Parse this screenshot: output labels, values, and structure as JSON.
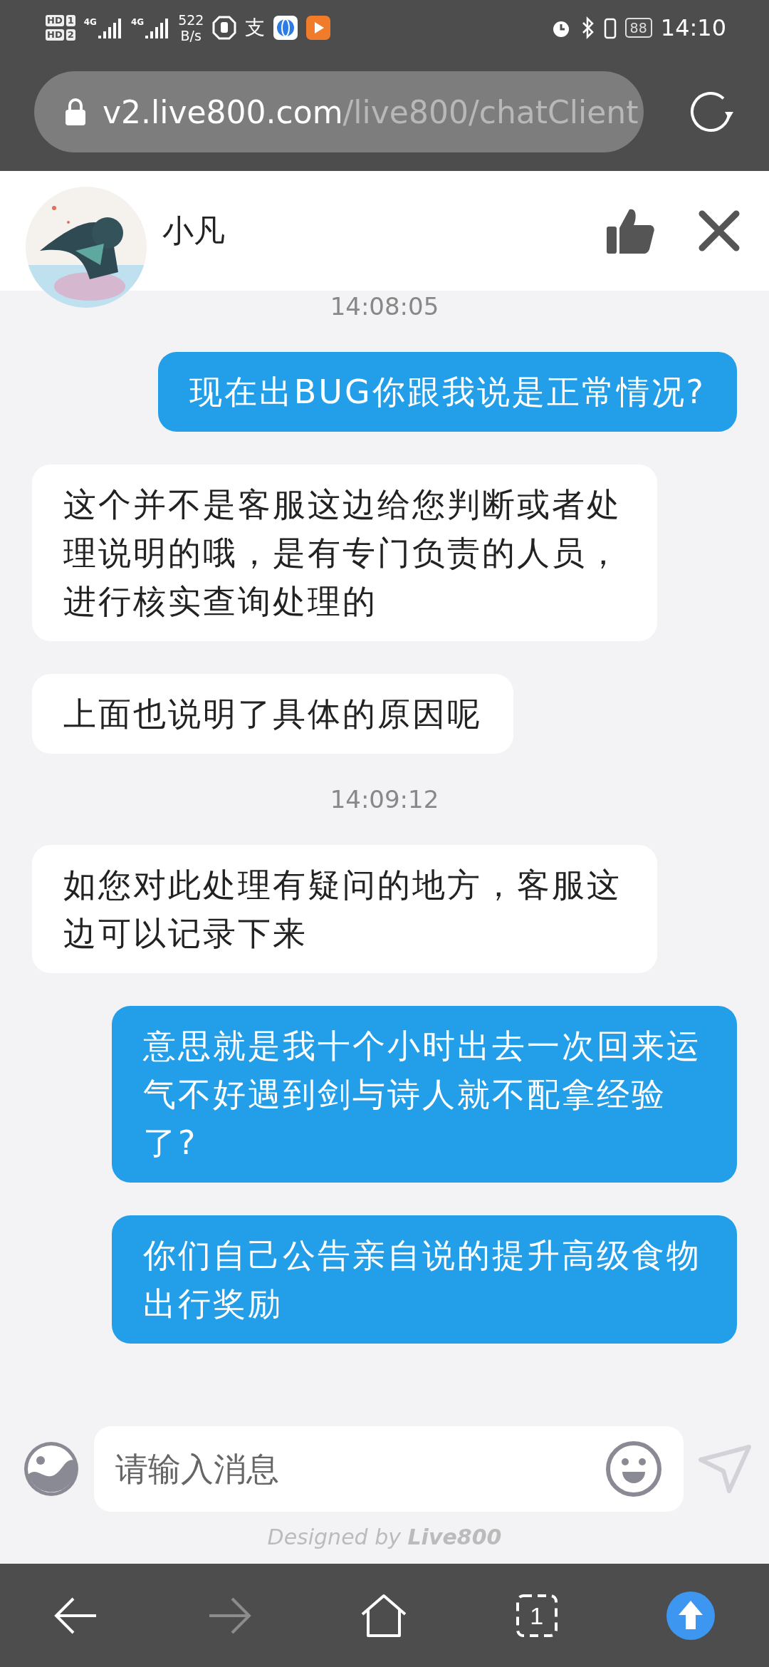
{
  "status_bar": {
    "sim_badges": [
      {
        "label": "HD",
        "slot": "1"
      },
      {
        "label": "HD",
        "slot": "2"
      }
    ],
    "networks": [
      "4G",
      "4G"
    ],
    "speed": "522",
    "speed_unit": "B/s",
    "app_glyph": "支",
    "battery": "88",
    "time": "14:10"
  },
  "address_bar": {
    "domain": "v2.live800.com",
    "path": "/live800/chatClient"
  },
  "header": {
    "name": "小凡"
  },
  "messages": [
    {
      "kind": "time",
      "text": "14:08:05"
    },
    {
      "kind": "sent",
      "text": "现在出BUG你跟我说是正常情况?"
    },
    {
      "kind": "received",
      "text": "这个并不是客服这边给您判断或者处理说明的哦，是有专门负责的人员，进行核实查询处理的"
    },
    {
      "kind": "received",
      "text": "上面也说明了具体的原因呢"
    },
    {
      "kind": "time",
      "text": "14:09:12"
    },
    {
      "kind": "received",
      "text": "如您对此处理有疑问的地方，客服这边可以记录下来"
    },
    {
      "kind": "sent",
      "text": "意思就是我十个小时出去一次回来运气不好遇到剑与诗人就不配拿经验了?"
    },
    {
      "kind": "sent",
      "text": "你们自己公告亲自说的提升高级食物出行奖励"
    }
  ],
  "composer": {
    "placeholder": "请输入消息"
  },
  "footer": "Designed by **Live800**",
  "nav": {
    "tabs_count": "1",
    "forward_disabled": true
  }
}
